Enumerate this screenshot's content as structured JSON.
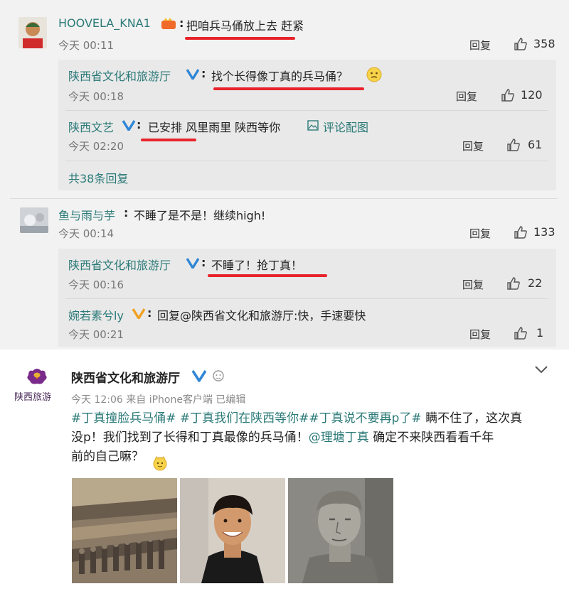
{
  "comments": [
    {
      "user": "HOOVELA_KNA1",
      "colon": ":",
      "text": "把咱兵马俑放上去 赶紧",
      "time": "今天 00:11",
      "reply": "回复",
      "likes": "358"
    },
    {
      "user": "陕西省文化和旅游厅",
      "colon": ":",
      "text": "找个长得像丁真的兵马俑？",
      "time": "今天 00:18",
      "reply": "回复",
      "likes": "120"
    },
    {
      "user": "陕西文艺",
      "colon": ":",
      "text": "已安排 风里雨里 陕西等你",
      "pic_label": "评论配图",
      "time": "今天 02:20",
      "reply": "回复",
      "likes": "61"
    },
    {
      "user": "鱼与雨与芋",
      "colon": ":",
      "text": "不睡了是不是！继续high!",
      "time": "今天 00:14",
      "reply": "回复",
      "likes": "133"
    },
    {
      "user": "陕西省文化和旅游厅",
      "colon": ":",
      "text": "不睡了！抢丁真！",
      "time": "今天 00:16",
      "reply": "回复",
      "likes": "22"
    },
    {
      "user": "婉若素兮ly",
      "colon": ":",
      "text": "回复@陕西省文化和旅游厅:快，手速要快",
      "time": "今天 00:21",
      "reply": "回复",
      "likes": "1"
    }
  ],
  "more_replies": "共38条回复",
  "post": {
    "author": "陕西省文化和旅游厅",
    "logo_text": "陕西旅游",
    "meta": "今天 12:06 来自 iPhone客户端  已编辑",
    "line1_tags": "#丁真撞脸兵马俑# #丁真我们在陕西等你##丁真说不要再p了#",
    "line1_rest": " 瞒不住了，这次真",
    "line2_a": "没p！我们找到了长得和丁真最像的兵马俑！",
    "line2_mention": "@理塘丁真",
    "line2_b": " 确定不来陕西看看千年",
    "line3": "前的自己嘛？"
  },
  "colors": {
    "accent_green": "#2b7a78",
    "highlight_red": "#e8232b",
    "like_gray": "#555555"
  }
}
